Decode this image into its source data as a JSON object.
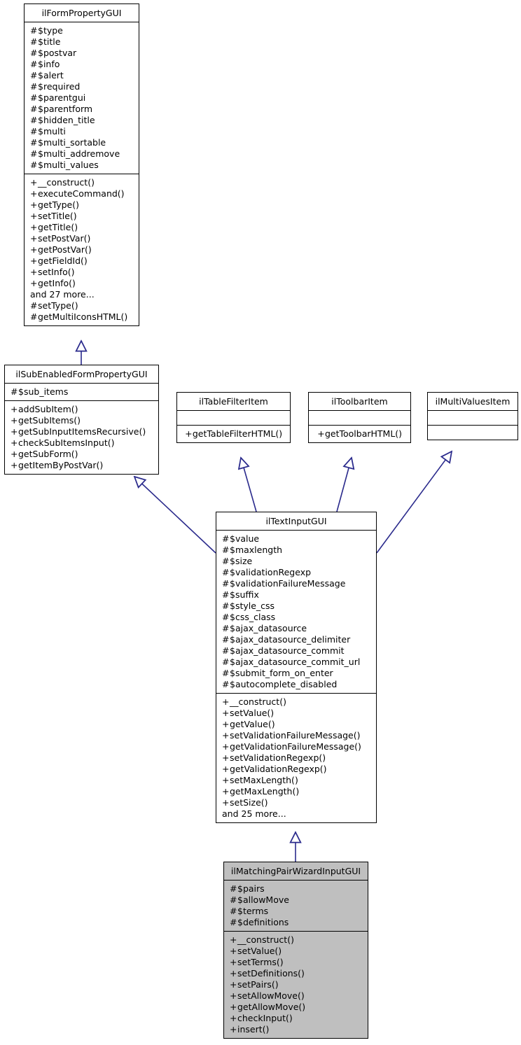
{
  "diagram": {
    "kind": "uml-class-inheritance-diagram",
    "edge_color": "#2a2a8c",
    "highlight_fill": "#bfbfbf",
    "box_fill": "#ffffff",
    "border_color": "#000000"
  },
  "classes": {
    "ilFormPropertyGUI": {
      "name": "ilFormPropertyGUI",
      "attributes": [
        "# $type",
        "# $title",
        "# $postvar",
        "# $info",
        "# $alert",
        "# $required",
        "# $parentgui",
        "# $parentform",
        "# $hidden_title",
        "# $multi",
        "# $multi_sortable",
        "# $multi_addremove",
        "# $multi_values"
      ],
      "operations": [
        "+ __construct()",
        "+ executeCommand()",
        "+ getType()",
        "+ setTitle()",
        "+ getTitle()",
        "+ setPostVar()",
        "+ getPostVar()",
        "+ getFieldId()",
        "+ setInfo()",
        "+ getInfo()",
        "and 27 more...",
        "# setType()",
        "# getMultiIconsHTML()"
      ]
    },
    "ilSubEnabledFormPropertyGUI": {
      "name": "ilSubEnabledFormPropertyGUI",
      "attributes": [
        "# $sub_items"
      ],
      "operations": [
        "+ addSubItem()",
        "+ getSubItems()",
        "+ getSubInputItemsRecursive()",
        "+ checkSubItemsInput()",
        "+ getSubForm()",
        "+ getItemByPostVar()"
      ]
    },
    "ilTableFilterItem": {
      "name": "ilTableFilterItem",
      "attributes": [],
      "operations": [
        "+ getTableFilterHTML()"
      ]
    },
    "ilToolbarItem": {
      "name": "ilToolbarItem",
      "attributes": [],
      "operations": [
        "+ getToolbarHTML()"
      ]
    },
    "ilMultiValuesItem": {
      "name": "ilMultiValuesItem",
      "attributes": [],
      "operations": []
    },
    "ilTextInputGUI": {
      "name": "ilTextInputGUI",
      "attributes": [
        "# $value",
        "# $maxlength",
        "# $size",
        "# $validationRegexp",
        "# $validationFailureMessage",
        "# $suffix",
        "# $style_css",
        "# $css_class",
        "# $ajax_datasource",
        "# $ajax_datasource_delimiter",
        "# $ajax_datasource_commit",
        "# $ajax_datasource_commit_url",
        "# $submit_form_on_enter",
        "# $autocomplete_disabled"
      ],
      "operations": [
        "+ __construct()",
        "+ setValue()",
        "+ getValue()",
        "+ setValidationFailureMessage()",
        "+ getValidationFailureMessage()",
        "+ setValidationRegexp()",
        "+ getValidationRegexp()",
        "+ setMaxLength()",
        "+ getMaxLength()",
        "+ setSize()",
        "and 25 more..."
      ]
    },
    "ilMatchingPairWizardInputGUI": {
      "name": "ilMatchingPairWizardInputGUI",
      "attributes": [
        "# $pairs",
        "# $allowMove",
        "# $terms",
        "# $definitions"
      ],
      "operations": [
        "+ __construct()",
        "+ setValue()",
        "+ setTerms()",
        "+ setDefinitions()",
        "+ setPairs()",
        "+ setAllowMove()",
        "+ getAllowMove()",
        "+ checkInput()",
        "+ insert()"
      ]
    }
  }
}
